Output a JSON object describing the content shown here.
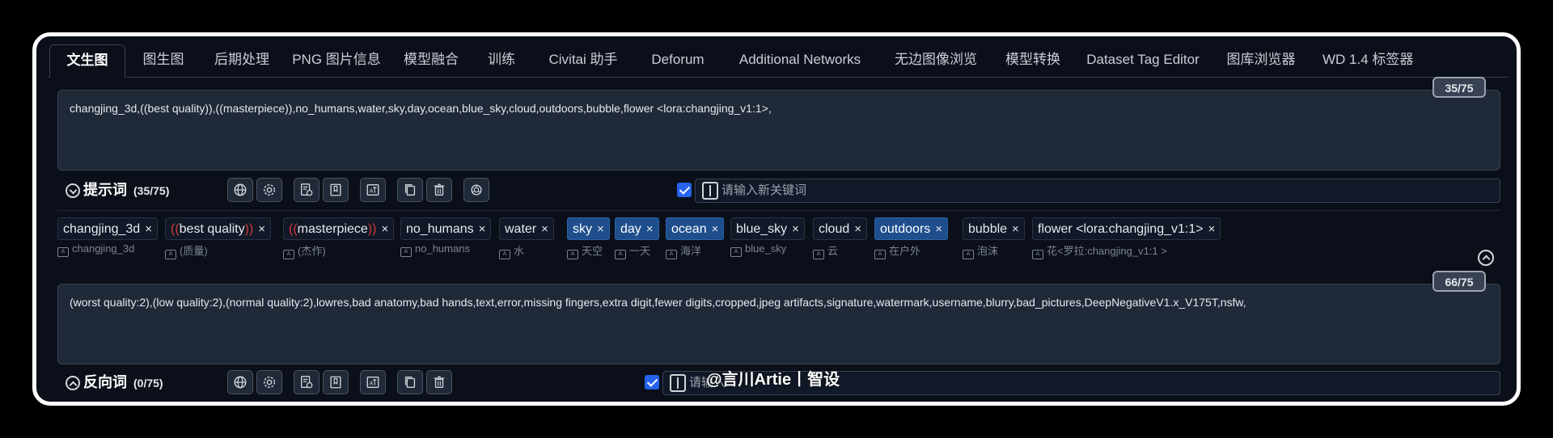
{
  "tabs": [
    {
      "label": "文生图",
      "active": true
    },
    {
      "label": "图生图"
    },
    {
      "label": "后期处理"
    },
    {
      "label": "PNG 图片信息"
    },
    {
      "label": "模型融合"
    },
    {
      "label": "训练"
    },
    {
      "label": "Civitai 助手"
    },
    {
      "label": "Deforum"
    },
    {
      "label": "Additional Networks"
    },
    {
      "label": "无边图像浏览"
    },
    {
      "label": "模型转换"
    },
    {
      "label": "Dataset Tag Editor"
    },
    {
      "label": "图库浏览器"
    },
    {
      "label": "WD 1.4 标签器"
    }
  ],
  "positive": {
    "counter": "35/75",
    "text": "changjing_3d,((best quality)),((masterpiece)),no_humans,water,sky,day,ocean,blue_sky,cloud,outdoors,bubble,flower <lora:changjing_v1:1>,",
    "title": "提示词",
    "count": "(35/75)",
    "keyword_placeholder": "请输入新关键词"
  },
  "tags": [
    {
      "label": "changjing_3d",
      "trans": "changjing_3d"
    },
    {
      "label_pre": "((",
      "label": "best quality",
      "label_post": "))",
      "trans": "(质量)"
    },
    {
      "label_pre": "((",
      "label": "masterpiece",
      "label_post": "))",
      "trans": "(杰作)"
    },
    {
      "label": "no_humans",
      "trans": "no_humans"
    },
    {
      "label": "water",
      "trans": "水"
    },
    {
      "label": "sky",
      "trans": "天空",
      "highlight": true
    },
    {
      "label": "day",
      "trans": "一天",
      "highlight": true
    },
    {
      "label": "ocean",
      "trans": "海洋",
      "highlight": true
    },
    {
      "label": "blue_sky",
      "trans": "blue_sky"
    },
    {
      "label": "cloud",
      "trans": "云"
    },
    {
      "label": "outdoors",
      "trans": "在户外",
      "highlight": true
    },
    {
      "label": "bubble",
      "trans": "泡沫"
    },
    {
      "label": "flower <lora:changjing_v1:1>",
      "trans": "花<罗拉:changjing_v1:1 >"
    }
  ],
  "negative": {
    "counter": "66/75",
    "text": "(worst quality:2),(low quality:2),(normal quality:2),lowres,bad anatomy,bad hands,text,error,missing fingers,extra digit,fewer digits,cropped,jpeg artifacts,signature,watermark,username,blurry,bad_pictures,DeepNegativeV1.x_V175T,nsfw,",
    "title": "反向词",
    "count": "(0/75)",
    "keyword_placeholder": "请输入"
  },
  "watermark": "@言川Artie丨智设",
  "tag_remove_glyph": "×",
  "colors": {
    "accent": "#2563eb",
    "tag_highlight": "#1e4e8c",
    "paren": "#d43a3a",
    "frame": "#ffffff"
  }
}
